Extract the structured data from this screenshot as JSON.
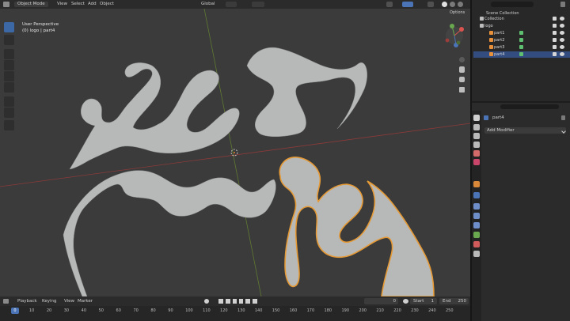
{
  "header": {
    "mode": "Object Mode",
    "menus": [
      "View",
      "Select",
      "Add",
      "Object"
    ],
    "transform_orientation": "Global",
    "options_label": "Options"
  },
  "viewport": {
    "overlay_line1": "User Perspective",
    "overlay_line2": "(0) logo | part4"
  },
  "outliner": {
    "title": "Scene Collection",
    "items": [
      {
        "label": "Collection",
        "level": 1
      },
      {
        "label": "logo",
        "level": 1
      },
      {
        "label": "part1",
        "level": 2
      },
      {
        "label": "part2",
        "level": 2
      },
      {
        "label": "part3",
        "level": 2
      },
      {
        "label": "part4",
        "level": 2,
        "selected": true
      }
    ]
  },
  "properties": {
    "object_name": "part4",
    "add_modifier": "Add Modifier"
  },
  "timeline": {
    "menus": [
      "Playback",
      "Keying",
      "View",
      "Marker"
    ],
    "current_frame": "0",
    "start_label": "Start",
    "start_value": "1",
    "end_label": "End",
    "end_value": "250",
    "frame_ticks": [
      "0",
      "10",
      "20",
      "30",
      "40",
      "50",
      "60",
      "70",
      "80",
      "90",
      "100",
      "110",
      "120",
      "130",
      "140",
      "150",
      "160",
      "170",
      "180",
      "190",
      "200",
      "210",
      "220",
      "230",
      "240",
      "250"
    ],
    "playhead": "0"
  },
  "colors": {
    "accent": "#4a74b5",
    "selection": "#f29a2e",
    "mesh": "#b7b8b8",
    "viewport_bg": "#3b3b3b"
  }
}
